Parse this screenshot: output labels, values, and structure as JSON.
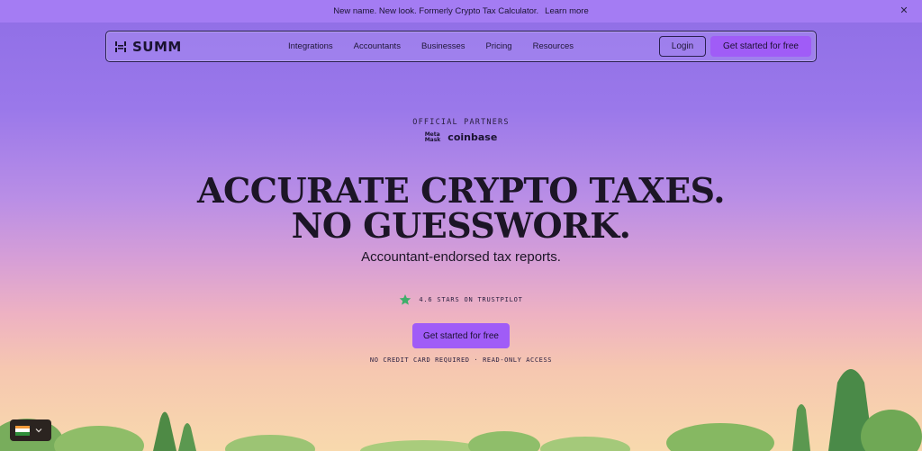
{
  "announcement": {
    "message": "New name. New look. Formerly Crypto Tax Calculator.",
    "link": "Learn more",
    "close_icon": "close-icon"
  },
  "nav": {
    "logo_text": "SUMM",
    "logo_icon": "summ-logo-icon",
    "menu": [
      {
        "label": "Integrations"
      },
      {
        "label": "Accountants"
      },
      {
        "label": "Businesses"
      },
      {
        "label": "Pricing"
      },
      {
        "label": "Resources"
      }
    ],
    "login_label": "Login",
    "cta_label": "Get started for free"
  },
  "hero": {
    "partners_label": "OFFICIAL PARTNERS",
    "partner_logos": {
      "metamask_line1": "Meta",
      "metamask_line2": "Mask",
      "coinbase": "coinbase"
    },
    "headline_line1": "ACCURATE CRYPTO TAXES.",
    "headline_line2": "NO GUESSWORK.",
    "subhead": "Accountant-endorsed tax reports.",
    "rating_text": "4.6 STARS ON TRUSTPILOT",
    "rating_icon": "trustpilot-star-icon",
    "cta_label": "Get started for free",
    "fineprint": "NO CREDIT CARD REQUIRED · READ-ONLY ACCESS"
  },
  "language_selector": {
    "flag_icon": "india-flag-icon",
    "chevron_icon": "chevron-down-icon"
  },
  "colors": {
    "accent": "#a05cf7",
    "announcement_bg": "#a47cf3",
    "trustpilot_green": "#3fae6a",
    "text": "#1c1526"
  }
}
